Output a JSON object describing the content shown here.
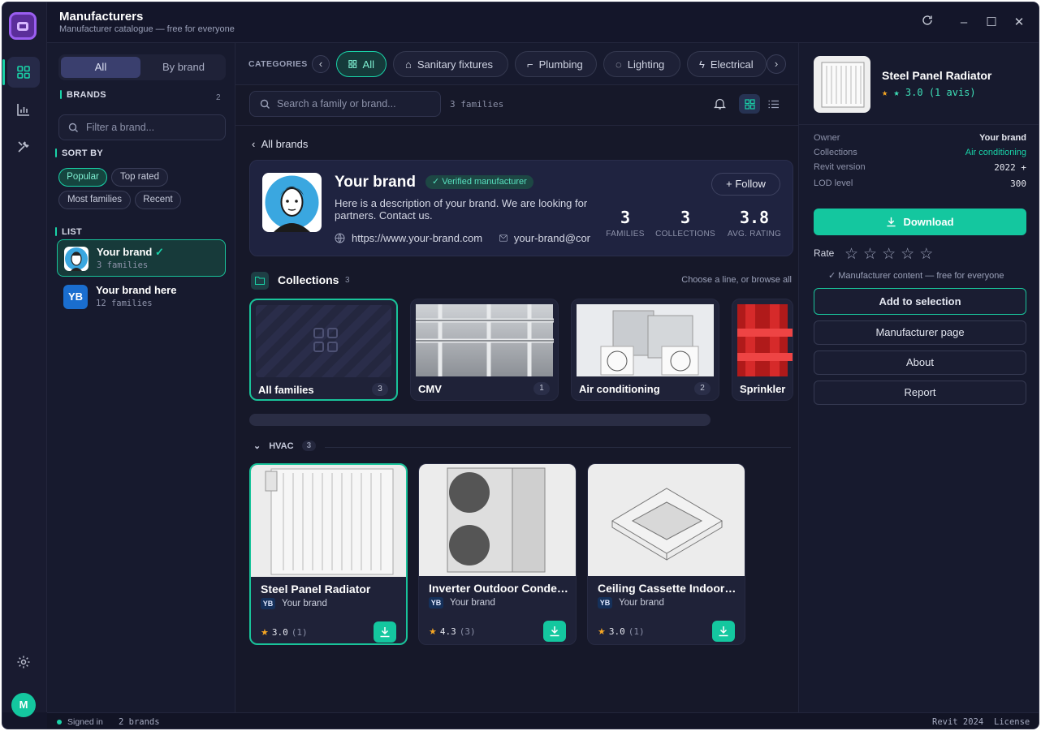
{
  "app": {
    "title": "Manufacturers",
    "subtitle": "Manufacturer catalogue — free for everyone"
  },
  "left": {
    "seg_all": "All",
    "seg_brand": "By brand",
    "brands_label": "BRANDS",
    "brands_count": "2",
    "filter_placeholder": "Filter a brand...",
    "sort_label": "SORT BY",
    "sort": [
      "Popular",
      "Top rated",
      "Most families",
      "Recent"
    ],
    "list_label": "LIST",
    "items": [
      {
        "name": "Your brand",
        "sub": "3 families",
        "verified": "✓"
      },
      {
        "name": "Your brand here",
        "sub": "12 families",
        "initials": "YB"
      }
    ]
  },
  "categories": {
    "label": "CATEGORIES",
    "items": [
      "All",
      "Sanitary fixtures",
      "Plumbing",
      "Lighting",
      "Electrical"
    ]
  },
  "toolbar": {
    "search_placeholder": "Search a family or brand...",
    "count": "3 families"
  },
  "back": "All brands",
  "brand": {
    "name": "Your brand",
    "verified": "✓ Verified manufacturer",
    "description": "Here is a description of your brand. We are looking for partners. Contact us.",
    "website": "https://www.your-brand.com",
    "email": "your-brand@cor",
    "follow": "+ Follow",
    "stats": [
      {
        "value": "3",
        "label": "FAMILIES"
      },
      {
        "value": "3",
        "label": "COLLECTIONS"
      },
      {
        "value": "3.8",
        "label": "AVG. RATING"
      }
    ]
  },
  "collections": {
    "title": "Collections",
    "count": "3",
    "hint": "Choose a line, or browse all",
    "items": [
      {
        "name": "All families",
        "count": "3"
      },
      {
        "name": "CMV",
        "count": "1"
      },
      {
        "name": "Air conditioning",
        "count": "2"
      },
      {
        "name": "Sprinkler",
        "count": ""
      }
    ]
  },
  "group": {
    "name": "HVAC",
    "count": "3"
  },
  "products": [
    {
      "name": "Steel Panel Radiator",
      "brand": "Your brand",
      "initials": "YB",
      "rating": "3.0",
      "votes": "(1)"
    },
    {
      "name": "Inverter Outdoor Condensing Unit",
      "brand": "Your brand",
      "initials": "YB",
      "rating": "4.3",
      "votes": "(3)"
    },
    {
      "name": "Ceiling Cassette Indoor Unit",
      "brand": "Your brand",
      "initials": "YB",
      "rating": "3.0",
      "votes": "(1)"
    }
  ],
  "detail": {
    "title": "Steel Panel Radiator",
    "rating": "★ 3.0 (1 avis)",
    "fields": [
      {
        "k": "Owner",
        "v": "Your brand"
      },
      {
        "k": "Collections",
        "v": "Air conditioning"
      },
      {
        "k": "Revit version",
        "v": "2022 +"
      },
      {
        "k": "LOD level",
        "v": "300"
      }
    ],
    "download": "Download",
    "rate": "Rate",
    "note": "✓ Manufacturer content — free for everyone",
    "add": "Add to selection",
    "page": "Manufacturer page",
    "about": "About",
    "report": "Report"
  },
  "status": {
    "signed": "Signed in",
    "brands": "2 brands",
    "revit": "Revit 2024",
    "license": "License"
  },
  "colors": {
    "accent": "#19d3a8",
    "bg": "#14162a",
    "star": "#f5a623"
  }
}
